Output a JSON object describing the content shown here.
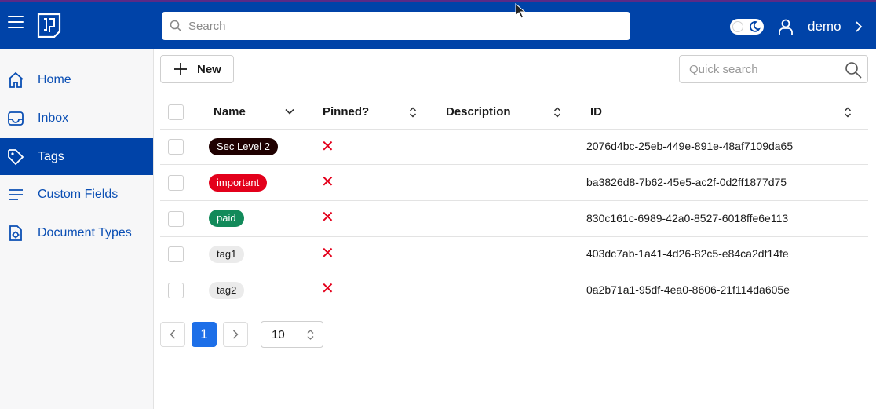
{
  "header": {
    "search_placeholder": "Search",
    "username": "demo",
    "accent_color": "#0043a8"
  },
  "sidebar": {
    "items": [
      {
        "label": "Home",
        "icon": "home-icon",
        "active": false
      },
      {
        "label": "Inbox",
        "icon": "inbox-icon",
        "active": false
      },
      {
        "label": "Tags",
        "icon": "tag-icon",
        "active": true
      },
      {
        "label": "Custom Fields",
        "icon": "list-icon",
        "active": false
      },
      {
        "label": "Document Types",
        "icon": "document-type-icon",
        "active": false
      }
    ]
  },
  "toolbar": {
    "new_label": "New",
    "quick_search_placeholder": "Quick search"
  },
  "table": {
    "columns": [
      "Name",
      "Pinned?",
      "Description",
      "ID"
    ],
    "rows": [
      {
        "name": "Sec Level 2",
        "tag_bg": "#1f0000",
        "tag_fg": "#ffffff",
        "pinned": "✕",
        "description": "",
        "id": "2076d4bc-25eb-449e-891e-48af7109da65"
      },
      {
        "name": "important",
        "tag_bg": "#e3001b",
        "tag_fg": "#ffffff",
        "pinned": "✕",
        "description": "",
        "id": "ba3826d8-7b62-45e5-ac2f-0d2ff1877d75"
      },
      {
        "name": "paid",
        "tag_bg": "#128a5a",
        "tag_fg": "#ffffff",
        "pinned": "✕",
        "description": "",
        "id": "830c161c-6989-42a0-8527-6018ffe6e113"
      },
      {
        "name": "tag1",
        "tag_bg": "#ebebeb",
        "tag_fg": "#1a1a1a",
        "pinned": "✕",
        "description": "",
        "id": "403dc7ab-1a41-4d26-82c5-e84ca2df14fe"
      },
      {
        "name": "tag2",
        "tag_bg": "#ebebeb",
        "tag_fg": "#1a1a1a",
        "pinned": "✕",
        "description": "",
        "id": "0a2b71a1-95df-4ea0-8606-21f114da605e"
      }
    ]
  },
  "pagination": {
    "current_page": "1",
    "page_size": "10"
  }
}
